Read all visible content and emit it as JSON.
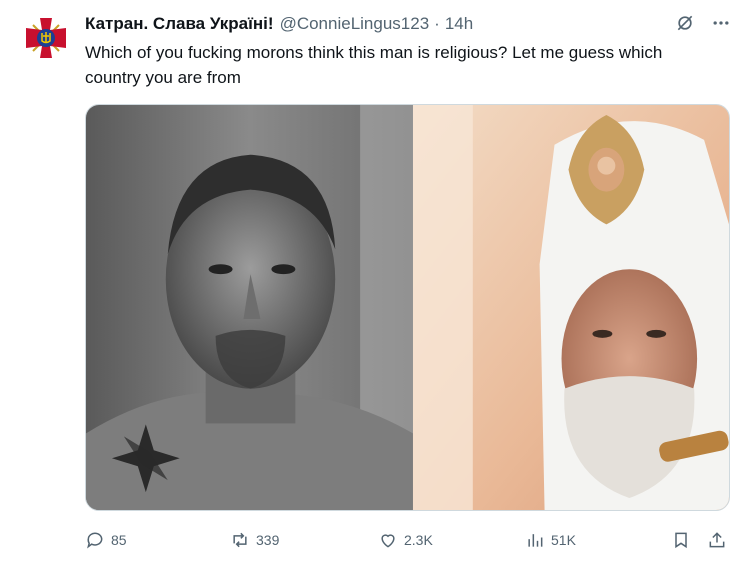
{
  "author": {
    "display_name": "Катран. Слава Україні!",
    "handle": "@ConnieLingus123",
    "separator": "·",
    "time": "14h"
  },
  "tweet": {
    "text": "Which of you fucking morons think this man is religious? Let me guess which country you are from"
  },
  "icons": {
    "grok": "grok-icon",
    "more": "more-icon",
    "reply": "reply-icon",
    "retweet": "retweet-icon",
    "like": "heart-icon",
    "views": "views-icon",
    "bookmark": "bookmark-icon",
    "share": "share-icon"
  },
  "stats": {
    "replies": "85",
    "retweets": "339",
    "likes": "2.3K",
    "views": "51K"
  },
  "colors": {
    "text": "#0f1419",
    "secondary": "#536471",
    "avatar_cross": "#c8102e",
    "avatar_trident": "#1c3f94"
  }
}
